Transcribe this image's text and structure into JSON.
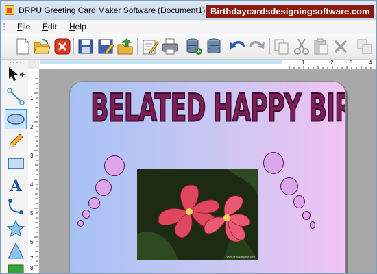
{
  "window": {
    "title": "DRPU Greeting Card Maker Software",
    "document": "(Document1)",
    "watermark": "Birthdaycardsdesigningsoftware.com"
  },
  "menu": {
    "items": [
      {
        "label": "File",
        "mnemonic": "F"
      },
      {
        "label": "Edit",
        "mnemonic": "E"
      },
      {
        "label": "Help",
        "mnemonic": "H"
      }
    ]
  },
  "toolbar": {
    "icons": [
      "new-icon",
      "open-icon",
      "close-icon",
      "save-icon",
      "save-as-icon",
      "export-icon",
      "edit-icon",
      "print-icon",
      "database-add-icon",
      "database-icon",
      "undo-icon",
      "redo-icon",
      "copy-icon",
      "cut-icon",
      "paste-icon",
      "delete-icon",
      "duplicate-icon"
    ]
  },
  "palette": {
    "icons": [
      "pointer-icon",
      "line-icon",
      "ellipse-icon",
      "pencil-icon",
      "rectangle-icon",
      "text-icon",
      "curve-icon",
      "star-icon",
      "triangle-icon",
      "image-icon"
    ]
  },
  "rulers": {
    "horizontal_labels": [
      "1",
      "2",
      "3",
      "4"
    ],
    "vertical_labels": [
      "1",
      "2",
      "3",
      "4",
      "5",
      "6",
      "7",
      "8"
    ]
  },
  "card": {
    "title": "BELATED HAPPY BIRTHDAY",
    "photo_credit": "www.drpusoftware.com",
    "colors": {
      "gradient_start": "#a7c1f4",
      "gradient_end": "#f0c3f3",
      "title": "#7b1f58",
      "bubble": "#dda6ec"
    }
  }
}
